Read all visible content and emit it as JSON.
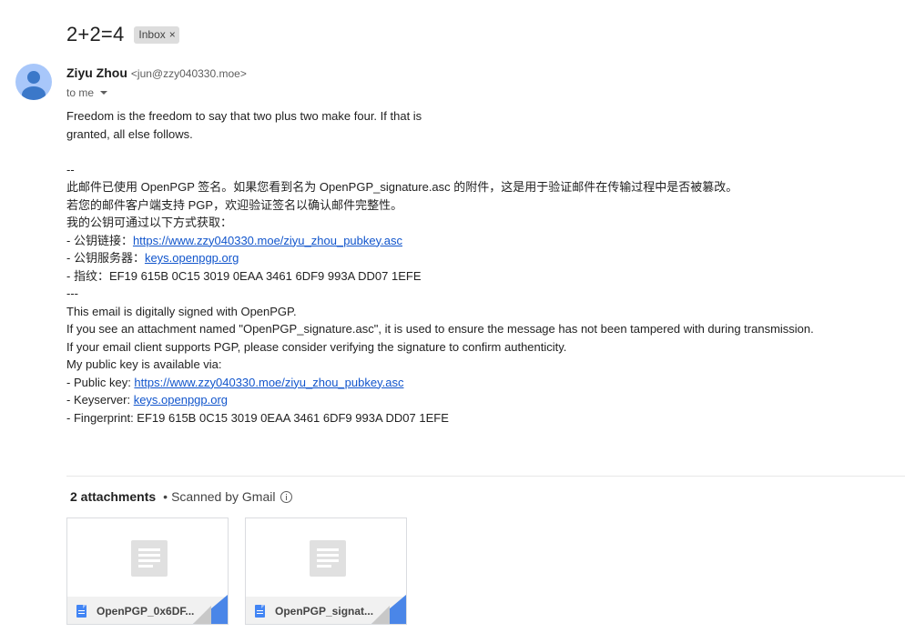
{
  "message": {
    "subject": "2+2=4",
    "label": "Inbox",
    "label_close": "×"
  },
  "sender": {
    "name": "Ziyu Zhou",
    "email": "<jun@zzy040330.moe>",
    "to_text": "to me"
  },
  "body_lines": {
    "l1": "Freedom is the freedom to say that two plus two make four. If that is",
    "l2": "granted, all else follows.",
    "l3": "--",
    "l4": "此邮件已使用 OpenPGP 签名。如果您看到名为 OpenPGP_signature.asc 的附件，这是用于验证邮件在传输过程中是否被篡改。",
    "l5": "若您的邮件客户端支持 PGP，欢迎验证签名以确认邮件完整性。",
    "l6": "我的公钥可通过以下方式获取：",
    "l7_prefix": "- 公钥链接：",
    "l7_link": "https://www.zzy040330.moe/ziyu_zhou_pubkey.asc",
    "l8_prefix": "- 公钥服务器：",
    "l8_link": "keys.openpgp.org",
    "l9": "- 指纹：EF19 615B 0C15 3019 0EAA 3461 6DF9 993A DD07 1EFE",
    "l10": "---",
    "l11": "This email is digitally signed with OpenPGP.",
    "l12": "If you see an attachment named \"OpenPGP_signature.asc\", it is used to ensure the message has not been tampered with during transmission.",
    "l13": "If your email client supports PGP, please consider verifying the signature to confirm authenticity.",
    "l14": "My public key is available via:",
    "l15_prefix": "- Public key: ",
    "l15_link": "https://www.zzy040330.moe/ziyu_zhou_pubkey.asc",
    "l16_prefix": "- Keyserver: ",
    "l16_link": "keys.openpgp.org",
    "l17": "- Fingerprint: EF19 615B 0C15 3019 0EAA 3461 6DF9 993A DD07 1EFE"
  },
  "attachments": {
    "count_label": "2 attachments",
    "separator": "•",
    "scanned_label": "Scanned by Gmail",
    "items": [
      {
        "name": "OpenPGP_0x6DF...",
        "icon": "doc-file-icon"
      },
      {
        "name": "OpenPGP_signat...",
        "icon": "doc-file-icon"
      }
    ]
  },
  "colors": {
    "link": "#1155cc",
    "avatar": "#a8c7fa",
    "file_icon": "#4285f4"
  }
}
